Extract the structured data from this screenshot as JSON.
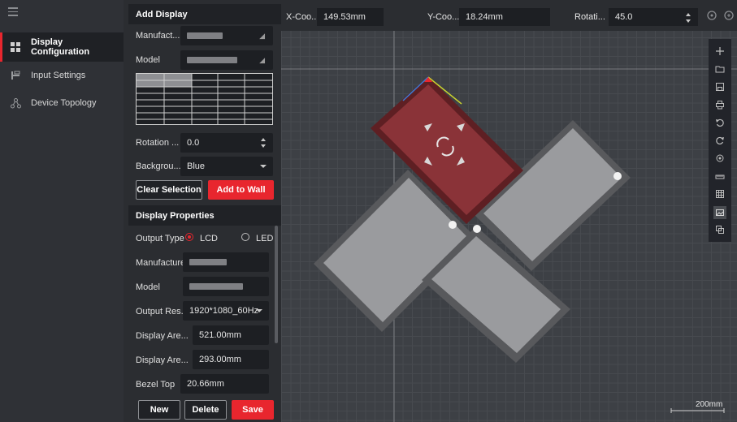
{
  "nav": {
    "items": [
      {
        "label": "Display Configuration",
        "icon": "display-config-icon",
        "active": true
      },
      {
        "label": "Input Settings",
        "icon": "input-settings-icon",
        "active": false
      },
      {
        "label": "Device Topology",
        "icon": "device-topology-icon",
        "active": false
      }
    ]
  },
  "add_display": {
    "title": "Add Display",
    "manufacturer_label": "Manufact...",
    "model_label": "Model",
    "rotation_label": "Rotation ...",
    "rotation_value": "0.0",
    "background_label": "Backgrou...",
    "background_value": "Blue",
    "clear_selection": "Clear Selection",
    "add_to_wall": "Add to Wall"
  },
  "display_properties": {
    "title": "Display Properties",
    "output_type_label": "Output Type",
    "option_lcd": "LCD",
    "option_led": "LED",
    "selected_output": "LCD",
    "manufacturer_label": "Manufacturer",
    "model_label": "Model",
    "output_res_label": "Output Res...",
    "output_res_value": "1920*1080_60Hz",
    "display_area_w_label": "Display Are...",
    "display_area_w_value": "521.00mm",
    "display_area_h_label": "Display Are...",
    "display_area_h_value": "293.00mm",
    "bezel_top_label": "Bezel Top",
    "bezel_top_value": "20.66mm",
    "new": "New",
    "delete": "Delete",
    "save": "Save"
  },
  "coords": {
    "x_label": "X-Coo...",
    "x_value": "149.53mm",
    "y_label": "Y-Coo...",
    "y_value": "18.24mm",
    "rot_label": "Rotati...",
    "rot_value": "45.0"
  },
  "scale_label": "200mm",
  "colors": {
    "accent": "#e8262e",
    "selected_fill": "#8a3338",
    "panel_fill": "#9a9b9e"
  },
  "toolbar_icons": [
    "add-icon",
    "open-folder-icon",
    "save-icon",
    "print-icon",
    "undo-icon",
    "redo-icon",
    "locate-icon",
    "ruler-icon",
    "grid-icon",
    "image-icon",
    "copy-layers-icon"
  ]
}
